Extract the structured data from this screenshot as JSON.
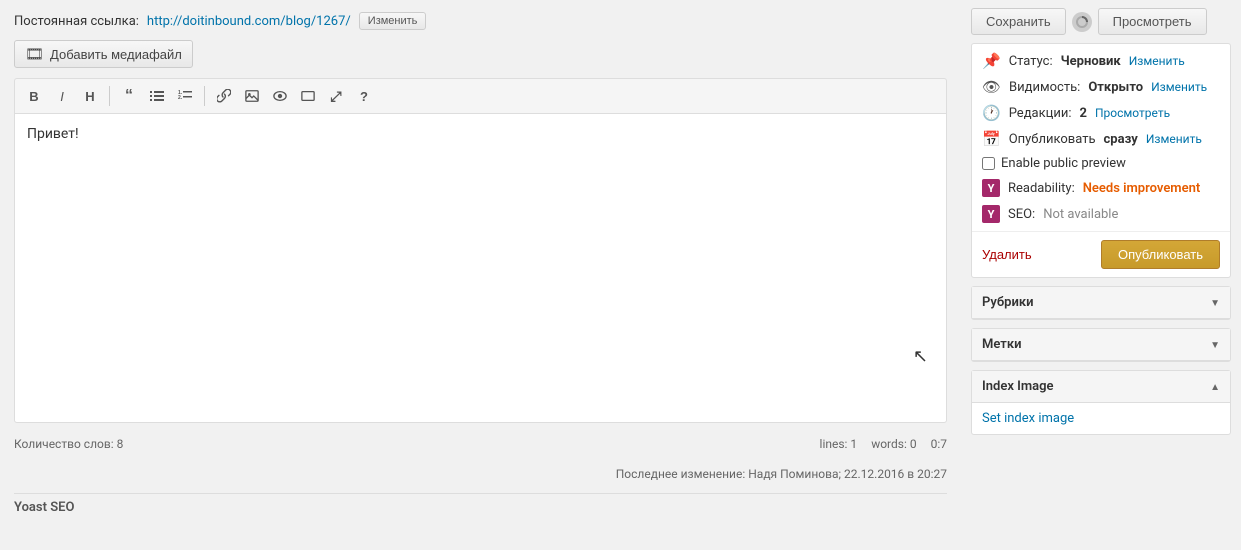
{
  "permalink": {
    "label": "Постоянная ссылка:",
    "url": "http://doitinbound.com/blog/1267/",
    "change_btn": "Изменить"
  },
  "media_btn": "Добавить медиафайл",
  "toolbar": {
    "bold": "B",
    "italic": "I",
    "heading": "H",
    "quote": "❝",
    "ul": "≡",
    "ol": "≡",
    "link": "🔗",
    "image": "🖼",
    "eye": "👁",
    "box": "▭",
    "fullscreen": "⤢",
    "help": "?"
  },
  "editor": {
    "content": "Привет!"
  },
  "editor_footer": {
    "word_count": "Количество слов: 8",
    "lines": "lines: 1",
    "words": "words: 0",
    "time": "0:7",
    "last_changed": "Последнее изменение: Надя Поминова; 22.12.2016 в 20:27"
  },
  "yoast_label": "Yoast SEO",
  "sidebar": {
    "save_btn": "Сохранить",
    "preview_btn": "Просмотреть",
    "publish_box": {
      "status_label": "Статус:",
      "status_value": "Черновик",
      "status_change": "Изменить",
      "visibility_label": "Видимость:",
      "visibility_value": "Открыто",
      "visibility_change": "Изменить",
      "revisions_label": "Редакции:",
      "revisions_value": "2",
      "revisions_link": "Просмотреть",
      "publish_label": "Опубликовать",
      "publish_time": "сразу",
      "publish_change": "Изменить",
      "enable_preview": "Enable public preview",
      "readability_label": "Readability:",
      "readability_value": "Needs improvement",
      "seo_label": "SEO:",
      "seo_value": "Not available",
      "delete_btn": "Удалить",
      "publish_btn": "Опубликовать"
    },
    "rubrics": {
      "title": "Рубрики"
    },
    "tags": {
      "title": "Метки"
    },
    "index_image": {
      "title": "Index Image",
      "link": "Set index image"
    }
  }
}
